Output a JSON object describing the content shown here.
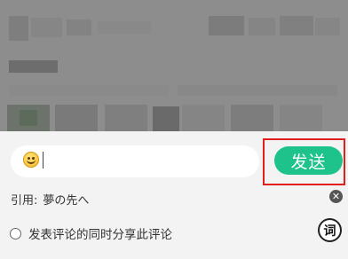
{
  "comment_box": {
    "input_value": "",
    "emoji": "smile-emoji"
  },
  "send_button": {
    "label": "发送",
    "color": "#1ec38c",
    "highlight_color": "#e01e1e"
  },
  "quote": {
    "label": "引用:",
    "text": "夢の先へ"
  },
  "share": {
    "label": "发表评论的同时分享此评论",
    "checked": false
  },
  "dict_button": {
    "label": "词"
  }
}
